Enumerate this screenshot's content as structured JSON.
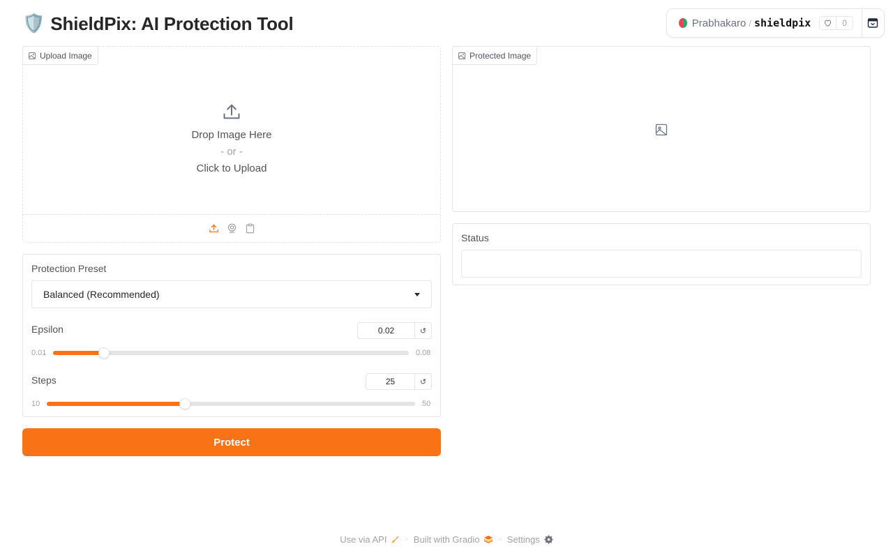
{
  "header": {
    "title_emoji": "🛡️",
    "title": "ShieldPix: AI Protection Tool"
  },
  "hf_bar": {
    "user": "Prabhakaro",
    "separator": "/",
    "space": "shieldpix",
    "likes": "0"
  },
  "upload": {
    "label": "Upload Image",
    "line1": "Drop Image Here",
    "line2": "- or -",
    "line3": "Click to Upload",
    "sources": [
      "upload-icon",
      "webcam-icon",
      "clipboard-icon"
    ]
  },
  "output": {
    "label": "Protected Image"
  },
  "status": {
    "label": "Status",
    "value": ""
  },
  "controls": {
    "preset_label": "Protection Preset",
    "preset_value": "Balanced (Recommended)",
    "epsilon": {
      "label": "Epsilon",
      "value": "0.02",
      "min": "0.01",
      "max": "0.08",
      "fraction": 0.143
    },
    "steps": {
      "label": "Steps",
      "value": "25",
      "min": "10",
      "max": "50",
      "fraction": 0.375
    }
  },
  "protect_button": "Protect",
  "footer": {
    "api": "Use via API",
    "built": "Built with Gradio",
    "settings": "Settings",
    "sep": "·"
  },
  "colors": {
    "accent": "#f97316",
    "border": "#e4e4e7",
    "text": "#27272a",
    "muted": "#a1a1aa"
  }
}
